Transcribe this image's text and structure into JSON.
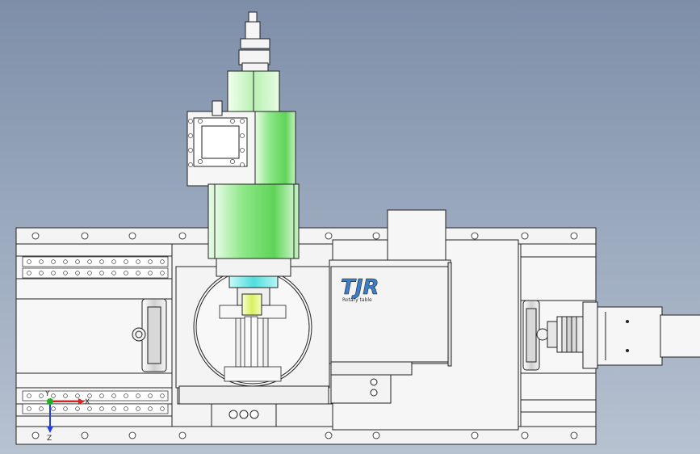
{
  "scene": {
    "logo_text": "TJR",
    "logo_subtitle": "Rotary table"
  },
  "triad": {
    "x_label": "X",
    "y_label": "Y",
    "z_label": "Z"
  },
  "colors": {
    "background_top": "#7d8ea8",
    "background_bottom": "#b7c2d1",
    "spindle_green": "#7ee07a",
    "spindle_cyan": "#6fe6e6",
    "part_fill": "#f4f4f4",
    "outline": "#222222",
    "axis_x": "#e02020",
    "axis_y": "#20b020",
    "axis_z": "#2040e0"
  }
}
